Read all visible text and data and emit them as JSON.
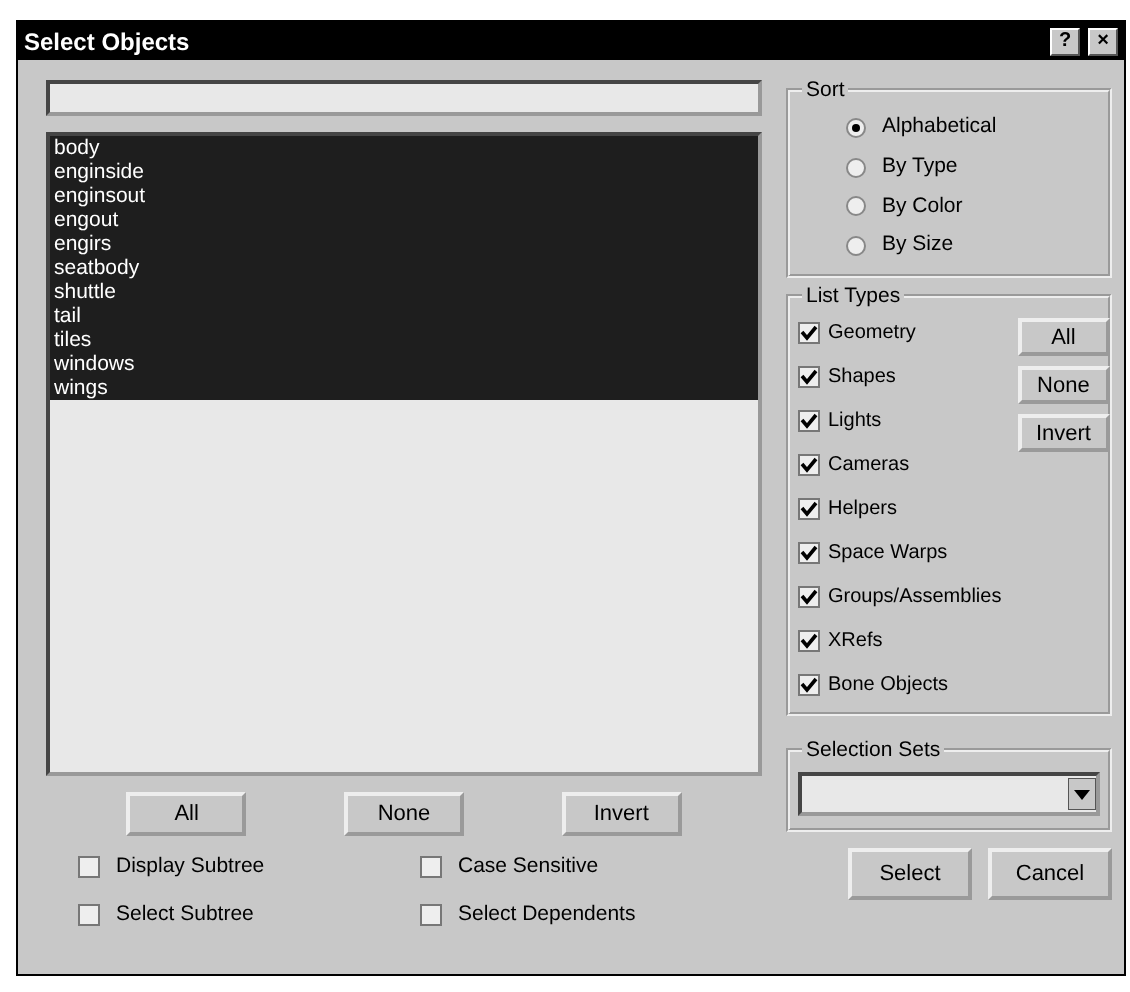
{
  "window": {
    "title": "Select Objects",
    "title_buttons": [
      "?",
      "×"
    ]
  },
  "objects": [
    {
      "name": "body",
      "selected": true
    },
    {
      "name": "enginside",
      "selected": true
    },
    {
      "name": "enginsout",
      "selected": true
    },
    {
      "name": "engout",
      "selected": true
    },
    {
      "name": "engirs",
      "selected": true
    },
    {
      "name": "seatbody",
      "selected": true
    },
    {
      "name": "shuttle",
      "selected": true
    },
    {
      "name": "tail",
      "selected": true
    },
    {
      "name": "tiles",
      "selected": true
    },
    {
      "name": "windows",
      "selected": true
    },
    {
      "name": "wings",
      "selected": true
    }
  ],
  "list_buttons": [
    "All",
    "None",
    "Invert"
  ],
  "options": [
    {
      "label": "Display Subtree",
      "checked": false
    },
    {
      "label": "Case Sensitive",
      "checked": false
    },
    {
      "label": "Select Subtree",
      "checked": false
    },
    {
      "label": "Select Dependents",
      "checked": false
    }
  ],
  "sort": {
    "title": "Sort",
    "options": [
      {
        "label": "Alphabetical",
        "selected": true
      },
      {
        "label": "By Type",
        "selected": false
      },
      {
        "label": "By Color",
        "selected": false
      },
      {
        "label": "By Size",
        "selected": false
      }
    ]
  },
  "list_types": {
    "title": "List Types",
    "types": [
      {
        "label": "Geometry",
        "checked": true
      },
      {
        "label": "Shapes",
        "checked": true
      },
      {
        "label": "Lights",
        "checked": true
      },
      {
        "label": "Cameras",
        "checked": true
      },
      {
        "label": "Helpers",
        "checked": true
      },
      {
        "label": "Space Warps",
        "checked": true
      },
      {
        "label": "Groups/Assemblies",
        "checked": true
      },
      {
        "label": "XRefs",
        "checked": true
      },
      {
        "label": "Bone Objects",
        "checked": true
      }
    ],
    "buttons": [
      "All",
      "None",
      "Invert"
    ]
  },
  "selection_sets": {
    "title": "Selection Sets"
  },
  "buttons": [
    "Select",
    "Cancel"
  ]
}
